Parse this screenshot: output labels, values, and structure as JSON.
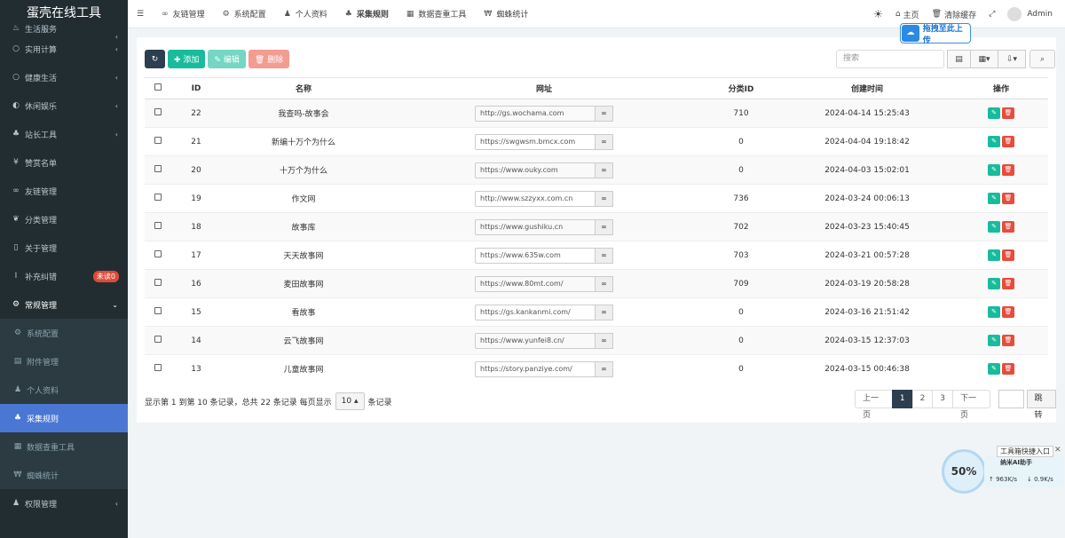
{
  "sidebar": {
    "brand": "蛋壳在线工具",
    "items": [
      {
        "label": "生活服务",
        "icon": "seedling-icon",
        "glyph": "♨"
      },
      {
        "label": "实用计算",
        "icon": "circle-icon",
        "glyph": "○"
      },
      {
        "label": "健康生活",
        "icon": "circle-icon",
        "glyph": "○"
      },
      {
        "label": "休闲娱乐",
        "icon": "gamepad-icon",
        "glyph": "◐"
      },
      {
        "label": "站长工具",
        "icon": "sitemap-icon",
        "glyph": "♣"
      },
      {
        "label": "赞赏名单",
        "icon": "yen-icon",
        "glyph": "¥"
      },
      {
        "label": "友链管理",
        "icon": "link-icon",
        "glyph": "∞"
      },
      {
        "label": "分类管理",
        "icon": "leaf-icon",
        "glyph": "❦"
      },
      {
        "label": "关于管理",
        "icon": "mobile-icon",
        "glyph": "▯"
      },
      {
        "label": "补充纠错",
        "icon": "text-height-icon",
        "glyph": "Ⅰ"
      },
      {
        "label": "常规管理",
        "icon": "cogs-icon",
        "glyph": "⚙"
      }
    ],
    "badge": "未读0",
    "subitems": [
      {
        "label": "系统配置",
        "glyph": "⚙"
      },
      {
        "label": "附件管理",
        "glyph": "▤"
      },
      {
        "label": "个人资料",
        "glyph": "♟"
      },
      {
        "label": "采集规则",
        "glyph": "♣"
      },
      {
        "label": "数据查重工具",
        "glyph": "▦"
      },
      {
        "label": "蜘蛛统计",
        "glyph": "₩"
      }
    ],
    "last": {
      "label": "权限管理",
      "glyph": "♟"
    }
  },
  "header": {
    "menu_glyph": "☰",
    "nav": [
      {
        "label": "友链管理",
        "glyph": "∞"
      },
      {
        "label": "系统配置",
        "glyph": "⚙"
      },
      {
        "label": "个人资料",
        "glyph": "♟"
      },
      {
        "label": "采集规则",
        "glyph": "♣"
      },
      {
        "label": "数据查重工具",
        "glyph": "▦"
      },
      {
        "label": "蜘蛛统计",
        "glyph": "₩"
      }
    ],
    "theme_glyph": "☀",
    "home": "主页",
    "clear_cache": "清除缓存",
    "fullscreen_glyph": "⤢",
    "user": "Admin",
    "upload_tip": "拖拽至此上传"
  },
  "toolbar": {
    "refresh_glyph": "↻",
    "add": "✚ 添加",
    "edit": "✎ 编辑",
    "delete": "🗑 删除",
    "search_placeholder": "搜索",
    "view_glyph": "▤",
    "columns_glyph": "▦▾",
    "export_glyph": "⇩▾",
    "search_glyph": "⌕"
  },
  "table": {
    "headers": [
      "ID",
      "名称",
      "网址",
      "分类ID",
      "创建时间",
      "操作"
    ],
    "rows": [
      {
        "id": "22",
        "name": "我查吗-故事会",
        "url": "http://gs.wochama.com",
        "cat": "710",
        "time": "2024-04-14 15:25:43"
      },
      {
        "id": "21",
        "name": "新编十万个为什么",
        "url": "https://swgwsm.bmcx.com",
        "cat": "0",
        "time": "2024-04-04 19:18:42"
      },
      {
        "id": "20",
        "name": "十万个为什么",
        "url": "https://www.ouky.com",
        "cat": "0",
        "time": "2024-04-03 15:02:01"
      },
      {
        "id": "19",
        "name": "作文网",
        "url": "http://www.szzyxx.com.cn",
        "cat": "736",
        "time": "2024-03-24 00:06:13"
      },
      {
        "id": "18",
        "name": "故事库",
        "url": "https://www.gushiku.cn",
        "cat": "702",
        "time": "2024-03-23 15:40:45"
      },
      {
        "id": "17",
        "name": "天天故事网",
        "url": "https://www.635w.com",
        "cat": "703",
        "time": "2024-03-21 00:57:28"
      },
      {
        "id": "16",
        "name": "麦田故事网",
        "url": "https://www.80mt.com/",
        "cat": "709",
        "time": "2024-03-19 20:58:28"
      },
      {
        "id": "15",
        "name": "看故事",
        "url": "https://gs.kankanmi.com/",
        "cat": "0",
        "time": "2024-03-16 21:51:42"
      },
      {
        "id": "14",
        "name": "云飞故事网",
        "url": "https://www.yunfei8.cn/",
        "cat": "0",
        "time": "2024-03-15 12:37:03"
      },
      {
        "id": "13",
        "name": "儿童故事网",
        "url": "https://story.panziye.com/",
        "cat": "0",
        "time": "2024-03-15 00:46:38"
      }
    ]
  },
  "footer": {
    "info_prefix": "显示第 1 到第 10 条记录，总共 22 条记录 每页显示",
    "page_size": "10 ▴",
    "info_suffix": "条记录",
    "prev": "上一页",
    "pages": [
      "1",
      "2",
      "3"
    ],
    "next": "下一页",
    "jump": "跳转"
  },
  "widget": {
    "percent": "50%",
    "tip": "工具箱快捷入口",
    "name": "纳米AI助手",
    "up": "↑ 963K/s",
    "down": "↓ 0.9K/s",
    "close": "✕"
  }
}
